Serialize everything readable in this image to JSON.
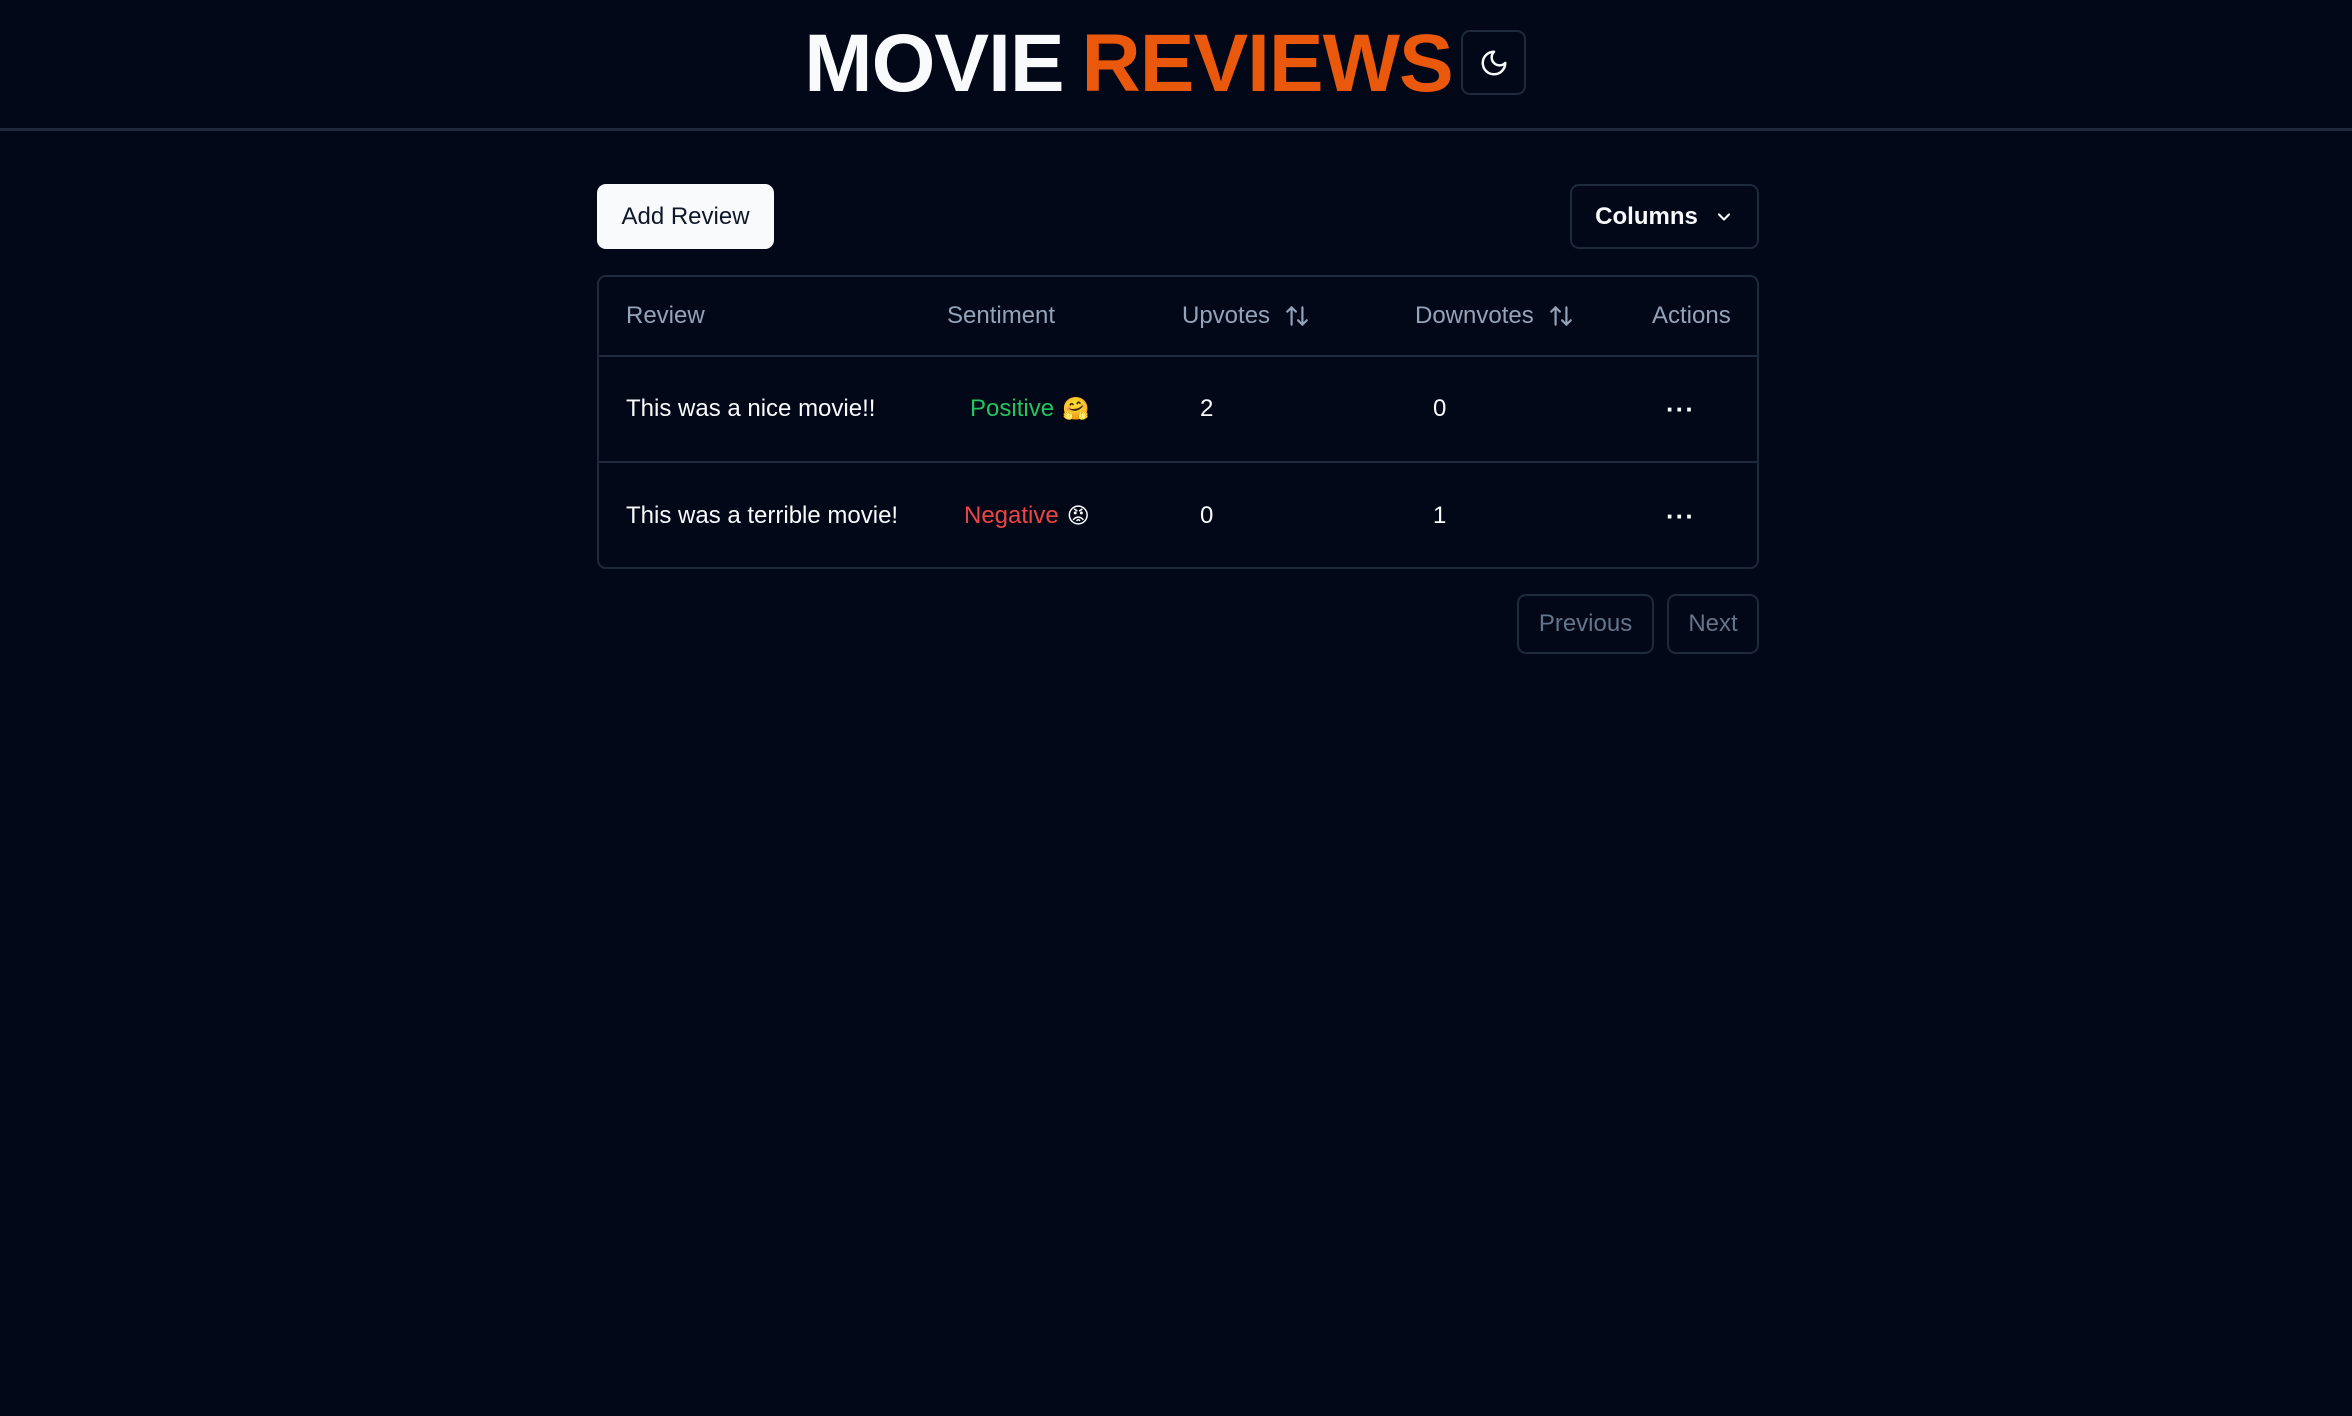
{
  "header": {
    "title_word1": "MOVIE",
    "title_word2": "REVIEWS",
    "theme_icon": "moon-icon",
    "accent_color": "#ea580c"
  },
  "toolbar": {
    "add_label": "Add Review",
    "columns_label": "Columns",
    "columns_icon": "chevron-down-icon"
  },
  "table": {
    "columns": [
      "Review",
      "Sentiment",
      "Upvotes",
      "Downvotes",
      "Actions"
    ],
    "sort_icon": "arrow-up-down-icon",
    "rows": [
      {
        "review": "This was a nice movie!!",
        "sentiment": "Positive",
        "emoji": "🤗",
        "upvotes": "2",
        "downvotes": "0",
        "actions": "···"
      },
      {
        "review": "This was a terrible movie!",
        "sentiment": "Negative",
        "emoji": "😡",
        "upvotes": "0",
        "downvotes": "1",
        "actions": "···"
      }
    ]
  },
  "pagination": {
    "previous_label": "Previous",
    "next_label": "Next"
  }
}
